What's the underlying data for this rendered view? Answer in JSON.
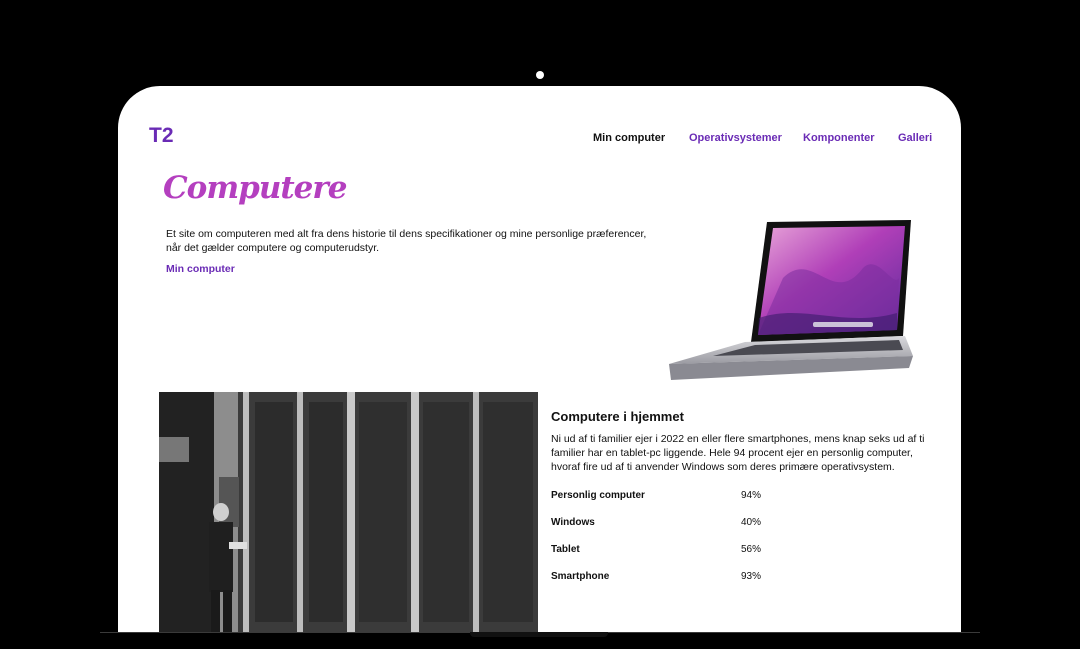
{
  "brand": {
    "logo": "T2",
    "accent": "#6a2bb5",
    "title_color": "#b43fbf"
  },
  "nav": [
    {
      "label": "Min computer",
      "active": true
    },
    {
      "label": "Operativsystemer",
      "active": false
    },
    {
      "label": "Komponenter",
      "active": false
    },
    {
      "label": "Galleri",
      "active": false
    }
  ],
  "hero": {
    "title": "Computere",
    "intro": "Et site om computeren med alt fra dens historie til dens specifikationer og mine personlige præferencer, når det gælder computere og computerudstyr.",
    "link": "Min computer"
  },
  "section": {
    "title": "Computere i hjemmet",
    "text": "Ni ud af ti familier ejer i 2022 en eller flere smartphones, mens knap seks ud af ti familier har en tablet-pc liggende. Hele 94 procent ejer en personlig computer, hvoraf fire ud af ti anvender Windows som deres primære operativsystem.",
    "stats": [
      {
        "label": "Personlig computer",
        "value": "94%"
      },
      {
        "label": "Windows",
        "value": "40%"
      },
      {
        "label": "Tablet",
        "value": "56%"
      },
      {
        "label": "Smartphone",
        "value": "93%"
      }
    ]
  }
}
